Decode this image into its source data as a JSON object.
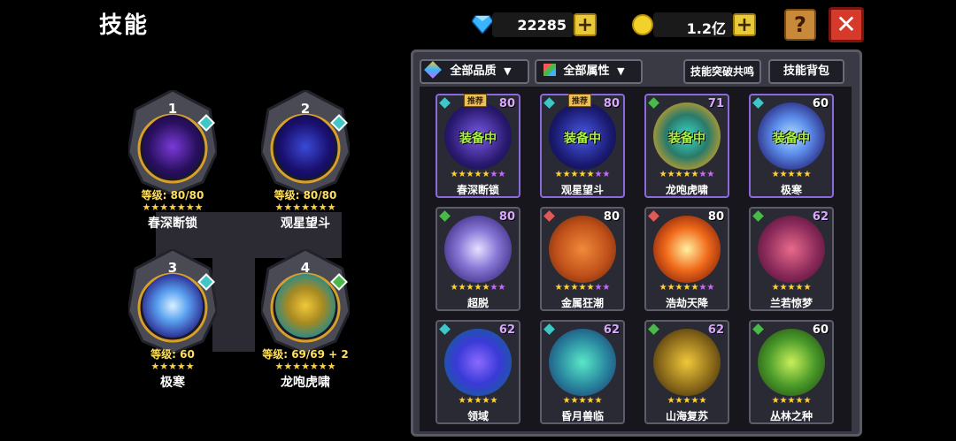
{
  "header": {
    "title": "技能",
    "help_label": "?",
    "close_label": "✕"
  },
  "currency": {
    "diamonds": "22285",
    "coins": "1.2亿",
    "plus_label": "+"
  },
  "toolbar": {
    "quality_filter": "全部品质",
    "attribute_filter": "全部属性",
    "breakthrough_label": "技能突破共鸣",
    "bag_label": "技能背包"
  },
  "equipped": [
    {
      "slot": "1",
      "level": "等级: 80/80",
      "name": "春深断锁",
      "stars": "★★★★★★★",
      "badge": "#3fc7c7"
    },
    {
      "slot": "2",
      "level": "等级: 80/80",
      "name": "观星望斗",
      "stars": "★★★★★★★",
      "badge": "#3fc7c7"
    },
    {
      "slot": "3",
      "level": "等级: 60",
      "name": "极寒",
      "stars": "★★★★★",
      "badge": "#3fc7c7"
    },
    {
      "slot": "4",
      "level": "等级: 69/69 + 2",
      "name": "龙咆虎啸",
      "stars": "★★★★★★★",
      "badge": "#4ab84a"
    }
  ],
  "skills": [
    {
      "name": "春深断锁",
      "level": "80",
      "equipped": "装备中",
      "tag": "推荐",
      "stars_gold": "★★★★★",
      "stars_purple": "★★",
      "gem": "#3fc7c7",
      "lvl_color": "#d8a8ff"
    },
    {
      "name": "观星望斗",
      "level": "80",
      "equipped": "装备中",
      "tag": "推荐",
      "stars_gold": "★★★★★",
      "stars_purple": "★★",
      "gem": "#3fc7c7",
      "lvl_color": "#d8a8ff"
    },
    {
      "name": "龙咆虎啸",
      "level": "71",
      "equipped": "装备中",
      "tag": "",
      "stars_gold": "★★★★★",
      "stars_purple": "★★",
      "gem": "#4ab84a",
      "lvl_color": "#d8a8ff"
    },
    {
      "name": "极寒",
      "level": "60",
      "equipped": "装备中",
      "tag": "",
      "stars_gold": "★★★★★",
      "stars_purple": "",
      "gem": "#3fc7c7",
      "lvl_color": "#ffffff"
    },
    {
      "name": "超脱",
      "level": "80",
      "equipped": "",
      "tag": "",
      "stars_gold": "★★★★★",
      "stars_purple": "★★",
      "gem": "#4ab84a",
      "lvl_color": "#d8a8ff"
    },
    {
      "name": "金属狂潮",
      "level": "80",
      "equipped": "",
      "tag": "",
      "stars_gold": "★★★★★",
      "stars_purple": "★★",
      "gem": "#e05a5a",
      "lvl_color": "#ffffff"
    },
    {
      "name": "浩劫天降",
      "level": "80",
      "equipped": "",
      "tag": "",
      "stars_gold": "★★★★★",
      "stars_purple": "★★",
      "gem": "#e05a5a",
      "lvl_color": "#ffffff"
    },
    {
      "name": "兰若惊梦",
      "level": "62",
      "equipped": "",
      "tag": "",
      "stars_gold": "★★★★★",
      "stars_purple": "",
      "gem": "#4ab84a",
      "lvl_color": "#d8a8ff"
    },
    {
      "name": "领域",
      "level": "62",
      "equipped": "",
      "tag": "",
      "stars_gold": "★★★★★",
      "stars_purple": "",
      "gem": "#3fc7c7",
      "lvl_color": "#d8a8ff"
    },
    {
      "name": "昏月兽临",
      "level": "62",
      "equipped": "",
      "tag": "",
      "stars_gold": "★★★★★",
      "stars_purple": "",
      "gem": "#3fc7c7",
      "lvl_color": "#d8a8ff"
    },
    {
      "name": "山海复苏",
      "level": "62",
      "equipped": "",
      "tag": "",
      "stars_gold": "★★★★★",
      "stars_purple": "",
      "gem": "#4ab84a",
      "lvl_color": "#d8a8ff"
    },
    {
      "name": "丛林之种",
      "level": "60",
      "equipped": "",
      "tag": "",
      "stars_gold": "★★★★★",
      "stars_purple": "",
      "gem": "#4ab84a",
      "lvl_color": "#ffffff"
    }
  ]
}
